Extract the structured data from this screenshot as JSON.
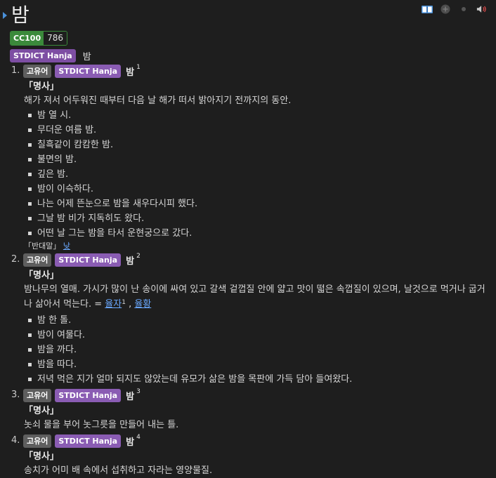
{
  "headword": "밤",
  "toolbar": {
    "icons": [
      "book-icon",
      "plus-circle-icon",
      "dot-icon",
      "speaker-icon"
    ],
    "colors": {
      "book": "#4a90d9",
      "speaker": "#d94a4a"
    }
  },
  "frequency_tag": {
    "label": "CC100",
    "value": "786"
  },
  "hanja_row": {
    "badge": "STDICT Hanja",
    "text": "밤"
  },
  "senses": [
    {
      "number": "1.",
      "origin_badge": "고유어",
      "source_badge": "STDICT Hanja",
      "headword": "밤",
      "superscript": "1",
      "pos": "「명사」",
      "definition": "해가 져서 어두워진 때부터 다음 날 해가 떠서 밝아지기 전까지의 동안.",
      "examples": [
        "밤 열 시.",
        "무더운 여름 밤.",
        "칠흑같이 캄캄한 밤.",
        "불면의 밤.",
        "깊은 밤.",
        "밤이 이슥하다.",
        "나는 어제 뜬눈으로 밤을 새우다시피 했다.",
        "그날 밤 비가 지독히도 왔다.",
        "어떤 날 그는 밤을 타서 운현궁으로 갔다."
      ],
      "antonym_label": "「반대말」",
      "antonym_link": "낮"
    },
    {
      "number": "2.",
      "origin_badge": "고유어",
      "source_badge": "STDICT Hanja",
      "headword": "밤",
      "superscript": "2",
      "pos": "「명사」",
      "definition": "밤나무의 열매. 가시가 많이 난 송이에 싸여 있고 갈색 겉껍질 안에 얇고 맛이 떫은 속껍질이 있으며, 날것으로 먹거나 굽거나 삶아서 먹는다. = ",
      "synonyms": [
        {
          "text": "율자",
          "sup": "1"
        },
        {
          "text": "율황",
          "sup": ""
        }
      ],
      "synonym_sep": " , ",
      "examples": [
        "밤 한 톨.",
        "밤이 여물다.",
        "밤을 까다.",
        "밤을 따다.",
        "저녁 먹은 지가 얼마 되지도 않았는데 유모가 삶은 밤을 목판에 가득 담아 들여왔다."
      ]
    },
    {
      "number": "3.",
      "origin_badge": "고유어",
      "source_badge": "STDICT Hanja",
      "headword": "밤",
      "superscript": "3",
      "pos": "「명사」",
      "definition": "놋쇠 물을 부어 놋그릇을 만들어 내는 틀."
    },
    {
      "number": "4.",
      "origin_badge": "고유어",
      "source_badge": "STDICT Hanja",
      "headword": "밤",
      "superscript": "4",
      "pos": "「명사」",
      "definition": "송치가 어미 배 속에서 섭취하고 자라는 영양물질."
    }
  ]
}
